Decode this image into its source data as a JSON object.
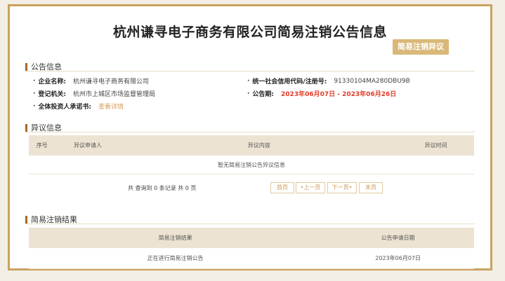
{
  "title": "杭州谦寻电子商务有限公司简易注销公告信息",
  "objection_button": "简易注销异议",
  "notice": {
    "heading": "公告信息",
    "company_label": "企业名称:",
    "company_value": "杭州谦寻电子商务有限公司",
    "credit_label": "统一社会信用代码/注册号:",
    "credit_value": "91330104MA280DBU9B",
    "authority_label": "登记机关:",
    "authority_value": "杭州市上城区市场监督管理局",
    "period_label": "公告期:",
    "period_value": "2023年06月07日 - 2023年06月26日",
    "pledge_label": "全体投资人承诺书:",
    "pledge_link": "查看详情"
  },
  "objection": {
    "heading": "异议信息",
    "columns": [
      "序号",
      "异议申请人",
      "异议内容",
      "异议时间"
    ],
    "empty_text": "暂无简易注销公告异议信息",
    "count_text": "共 查询到 0 条记录 共 0 页",
    "pager": {
      "first": "首页",
      "prev": "•上一页",
      "next": "下一页•",
      "last": "末页"
    }
  },
  "result": {
    "heading": "简易注销结果",
    "columns": [
      "简易注销结果",
      "公告申请日期"
    ],
    "rows": [
      {
        "result": "正在进行简易注销公告",
        "date": "2023年06月07日"
      }
    ]
  },
  "colors": {
    "accent": "#c9a25e",
    "button": "#d9b878",
    "highlight": "#e43a26",
    "link": "#d9a05a"
  }
}
